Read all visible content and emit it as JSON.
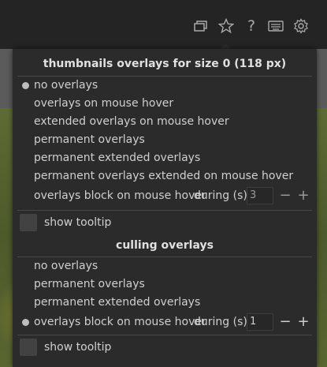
{
  "toolbar": {
    "icons": [
      "copy-icon",
      "star-icon",
      "help-icon",
      "keyboard-icon",
      "gear-icon"
    ]
  },
  "popup": {
    "section1": {
      "title": "thumbnails overlays for size 0 (118 px)",
      "options": [
        "no overlays",
        "overlays on mouse hover",
        "extended overlays on mouse hover",
        "permanent overlays",
        "permanent extended overlays",
        "permanent overlays extended on mouse hover",
        "overlays block on mouse hover"
      ],
      "selected_index": 0,
      "during_label": "during (s)",
      "during_value": "3",
      "tooltip_label": "show tooltip"
    },
    "section2": {
      "title": "culling overlays",
      "options": [
        "no overlays",
        "permanent overlays",
        "permanent extended overlays",
        "overlays block on mouse hover"
      ],
      "selected_index": 3,
      "during_label": "during (s)",
      "during_value": "1",
      "tooltip_label": "show tooltip"
    },
    "stepper": {
      "minus": "−",
      "plus": "+"
    }
  }
}
